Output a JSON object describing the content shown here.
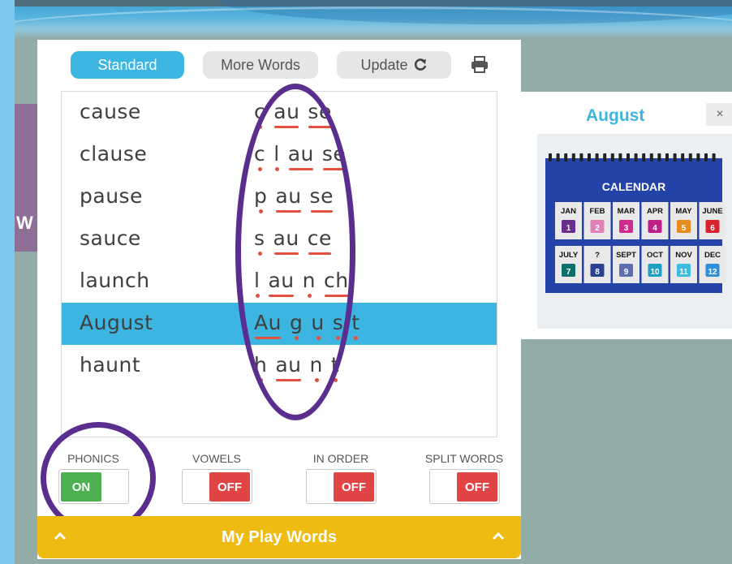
{
  "app": {
    "side_partial_text": "W"
  },
  "header": {
    "tabs": [
      {
        "label": "Standard",
        "active": true
      },
      {
        "label": "More Words",
        "active": false
      }
    ],
    "update_label": "Update",
    "refresh_icon": "refresh-icon",
    "print_icon": "printer-icon"
  },
  "words": [
    {
      "word": "cause",
      "segments": [
        {
          "t": "c",
          "m": "dot"
        },
        {
          "t": "au",
          "m": "line"
        },
        {
          "t": "se",
          "m": "line"
        }
      ]
    },
    {
      "word": "clause",
      "segments": [
        {
          "t": "c",
          "m": "dot"
        },
        {
          "t": "l",
          "m": "dot"
        },
        {
          "t": "au",
          "m": "line"
        },
        {
          "t": "se",
          "m": "line"
        }
      ]
    },
    {
      "word": "pause",
      "segments": [
        {
          "t": "p",
          "m": "dot"
        },
        {
          "t": "au",
          "m": "line"
        },
        {
          "t": "se",
          "m": "line"
        }
      ]
    },
    {
      "word": "sauce",
      "segments": [
        {
          "t": "s",
          "m": "dot"
        },
        {
          "t": "au",
          "m": "line"
        },
        {
          "t": "ce",
          "m": "line"
        }
      ]
    },
    {
      "word": "launch",
      "segments": [
        {
          "t": "l",
          "m": "dot"
        },
        {
          "t": "au",
          "m": "line"
        },
        {
          "t": "n",
          "m": "dot"
        },
        {
          "t": "ch",
          "m": "line"
        }
      ]
    },
    {
      "word": "August",
      "selected": true,
      "segments": [
        {
          "t": "Au",
          "m": "line"
        },
        {
          "t": "g",
          "m": "dot"
        },
        {
          "t": "u",
          "m": "dot"
        },
        {
          "t": "s",
          "m": "dot"
        },
        {
          "t": "t",
          "m": "dot"
        }
      ]
    },
    {
      "word": "haunt",
      "segments": [
        {
          "t": "h",
          "m": "dot"
        },
        {
          "t": "au",
          "m": "line"
        },
        {
          "t": "n",
          "m": "dot"
        },
        {
          "t": "t",
          "m": "dot"
        }
      ]
    }
  ],
  "toggles": [
    {
      "label": "PHONICS",
      "state": "ON"
    },
    {
      "label": "VOWELS",
      "state": "OFF"
    },
    {
      "label": "IN ORDER",
      "state": "OFF"
    },
    {
      "label": "SPLIT WORDS",
      "state": "OFF"
    }
  ],
  "footer": {
    "title": "My Play Words"
  },
  "popup": {
    "title": "August",
    "close": "×",
    "image": {
      "heading": "CALENDAR",
      "months": [
        "JAN",
        "FEB",
        "MAR",
        "APR",
        "MAY",
        "JUNE",
        "JULY",
        "?",
        "SEPT",
        "OCT",
        "NOV",
        "DEC"
      ],
      "numbers": [
        "1",
        "2",
        "3",
        "4",
        "5",
        "6",
        "7",
        "8",
        "9",
        "10",
        "11",
        "12"
      ]
    }
  },
  "colors": {
    "accent": "#3cb5e1",
    "on": "#4caf50",
    "off": "#e04444",
    "footer": "#eebb13",
    "annotation": "#5a2e8e",
    "phonics_mark": "#e0513f",
    "month_tiles": [
      "#6a2f8e",
      "#e27fb8",
      "#d02a8f",
      "#c01f8a",
      "#e98c1d",
      "#d8232e",
      "#0e6e6a",
      "#2a3f8e",
      "#5c6db0",
      "#1aa1c4",
      "#3bbbe0",
      "#2f8fd8"
    ]
  }
}
